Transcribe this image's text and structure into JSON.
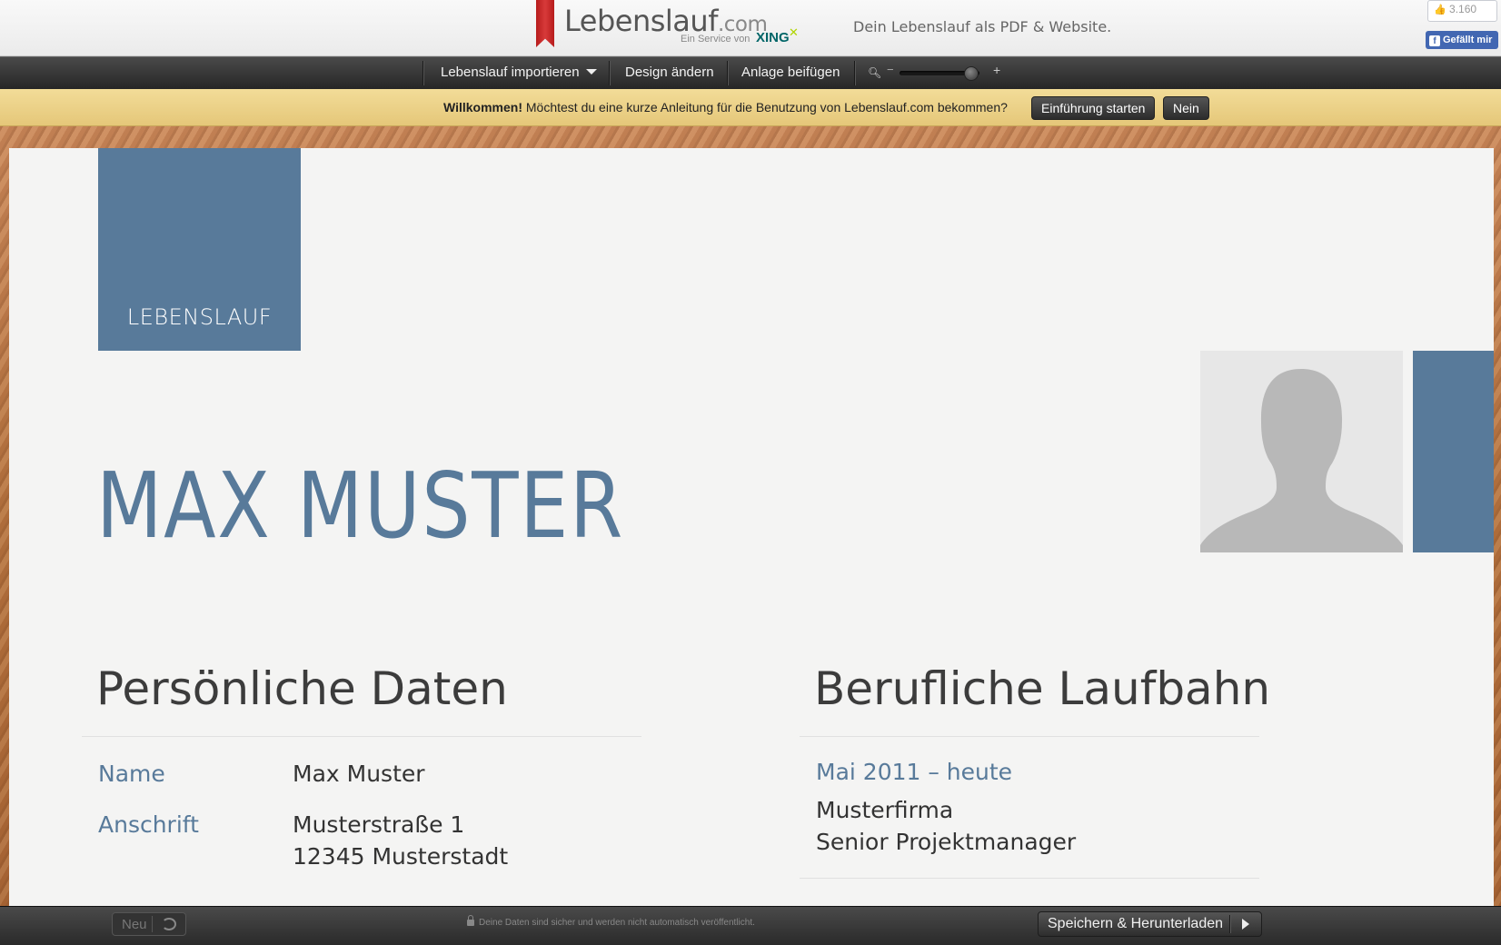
{
  "header": {
    "logo_main": "Lebenslauf",
    "logo_com": ".com",
    "logo_sub": "Ein Service von",
    "logo_xing": "XING",
    "tagline": "Dein Lebenslauf als PDF & Website.",
    "fb_count": "3.160",
    "fb_like_label": "Gefällt mir"
  },
  "nav": {
    "import_label": "Lebenslauf importieren",
    "design_label": "Design ändern",
    "attachment_label": "Anlage beifügen",
    "zoom_level": 0.9
  },
  "welcome": {
    "bold": "Willkommen!",
    "text": " Möchtest du eine kurze Anleitung für die Benutzung von Lebenslauf.com bekommen?",
    "start_label": "Einführung starten",
    "no_label": "Nein"
  },
  "cv": {
    "box_label": "LEBENSLAUF",
    "name": "MAX MUSTER",
    "personal": {
      "title": "Persönliche Daten",
      "name_label": "Name",
      "name_value": "Max Muster",
      "address_label": "Anschrift",
      "address_line1": "Musterstraße 1",
      "address_line2": "12345 Musterstadt"
    },
    "career": {
      "title": "Berufliche Laufbahn",
      "period": "Mai 2011 – heute",
      "company": "Musterfirma",
      "position": "Senior Projektmanager"
    }
  },
  "footer": {
    "new_label": "Neu",
    "secure_note": "Deine Daten sind sicher und werden nicht automatisch veröffentlicht.",
    "save_label": "Speichern & Herunterladen"
  },
  "colors": {
    "accent": "#587a9a",
    "toolbar": "#2e2e2e",
    "welcome_bg": "#ecd28a"
  }
}
